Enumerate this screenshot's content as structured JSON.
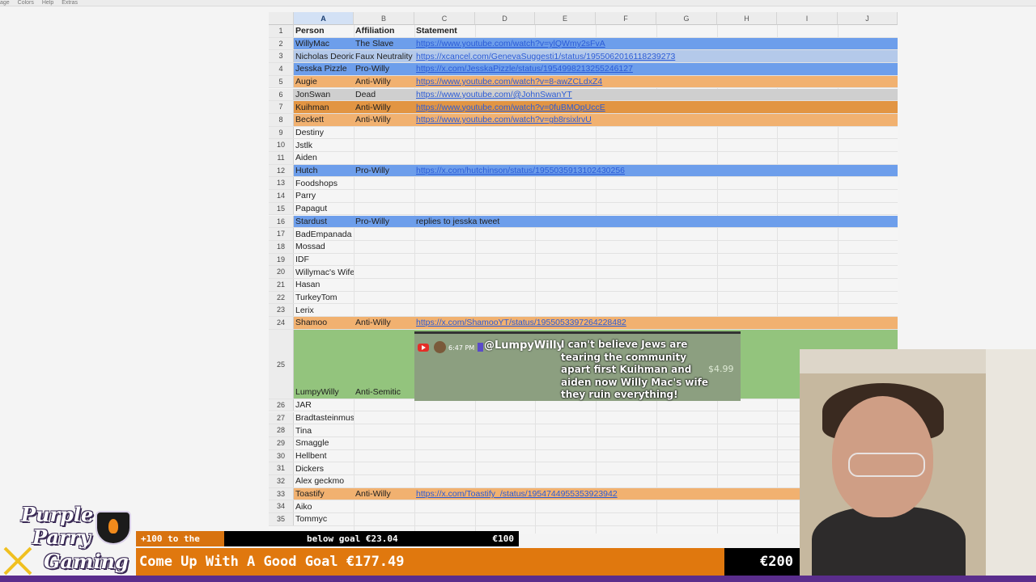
{
  "menubar": [
    "age",
    "Colors",
    "Help",
    "Extras"
  ],
  "columns": [
    {
      "letter": "A",
      "selected": true
    },
    {
      "letter": "B",
      "selected": false
    },
    {
      "letter": "C",
      "selected": false
    },
    {
      "letter": "D",
      "selected": false
    },
    {
      "letter": "E",
      "selected": false
    },
    {
      "letter": "F",
      "selected": false
    },
    {
      "letter": "G",
      "selected": false
    },
    {
      "letter": "H",
      "selected": false
    },
    {
      "letter": "I",
      "selected": false
    },
    {
      "letter": "J",
      "selected": false
    }
  ],
  "rows": [
    {
      "n": "1",
      "a": "Person",
      "b": "Affiliation",
      "c": "Statement",
      "color": "",
      "bold": true,
      "link": false
    },
    {
      "n": "2",
      "a": "WillyMac",
      "b": "The Slave",
      "c": "https://www.youtube.com/watch?v=ylQWmy2sFvA",
      "color": "blue",
      "link": true
    },
    {
      "n": "3",
      "a": "Nicholas Deorio",
      "b": "Faux Neutrality",
      "c": "https://xcancel.com/GenevaSuggesti1/status/1955062016118239273",
      "color": "lightblue",
      "link": true
    },
    {
      "n": "4",
      "a": "Jesska Pizzle",
      "b": "Pro-Willy",
      "c": "https://x.com/JesskaPizzle/status/1954998213255246127",
      "color": "blue",
      "link": true
    },
    {
      "n": "5",
      "a": "Augie",
      "b": "Anti-Willy",
      "c": "https://www.youtube.com/watch?v=8-awZCLdxZ4",
      "color": "orange",
      "link": true
    },
    {
      "n": "6",
      "a": "JonSwan",
      "b": "Dead",
      "c": "https://www.youtube.com/@JohnSwanYT",
      "color": "gray",
      "link": true
    },
    {
      "n": "7",
      "a": "Kuihman",
      "b": "Anti-Willy",
      "c": "https://www.youtube.com/watch?v=0fuBMOpUccE",
      "color": "darkorange",
      "link": true
    },
    {
      "n": "8",
      "a": "Beckett",
      "b": "Anti-Willy",
      "c": "https://www.youtube.com/watch?v=gb8rsixlrvU",
      "color": "orange",
      "link": true
    },
    {
      "n": "9",
      "a": "Destiny",
      "b": "",
      "c": "",
      "color": "",
      "link": false
    },
    {
      "n": "10",
      "a": "Jstlk",
      "b": "",
      "c": "",
      "color": "",
      "link": false
    },
    {
      "n": "11",
      "a": "Aiden",
      "b": "",
      "c": "",
      "color": "",
      "link": false
    },
    {
      "n": "12",
      "a": "Hutch",
      "b": "Pro-Willy",
      "c": "https://x.com/hutchinson/status/1955035913102430256",
      "color": "blue",
      "link": true
    },
    {
      "n": "13",
      "a": "Foodshops",
      "b": "",
      "c": "",
      "color": "",
      "link": false
    },
    {
      "n": "14",
      "a": "Parry",
      "b": "",
      "c": "",
      "color": "",
      "link": false
    },
    {
      "n": "15",
      "a": "Papagut",
      "b": "",
      "c": "",
      "color": "",
      "link": false
    },
    {
      "n": "16",
      "a": "Stardust",
      "b": "Pro-Willy",
      "c": "replies to jesska tweet",
      "color": "blue",
      "link": false
    },
    {
      "n": "17",
      "a": "BadEmpanada",
      "b": "",
      "c": "",
      "color": "",
      "link": false
    },
    {
      "n": "18",
      "a": "Mossad",
      "b": "",
      "c": "",
      "color": "",
      "link": false
    },
    {
      "n": "19",
      "a": "IDF",
      "b": "",
      "c": "",
      "color": "",
      "link": false
    },
    {
      "n": "20",
      "a": "Willymac's Wife",
      "b": "",
      "c": "",
      "color": "",
      "link": false
    },
    {
      "n": "21",
      "a": "Hasan",
      "b": "",
      "c": "",
      "color": "",
      "link": false
    },
    {
      "n": "22",
      "a": "TurkeyTom",
      "b": "",
      "c": "",
      "color": "",
      "link": false
    },
    {
      "n": "23",
      "a": "Lerix",
      "b": "",
      "c": "",
      "color": "",
      "link": false
    },
    {
      "n": "24",
      "a": "Shamoo",
      "b": "Anti-Willy",
      "c": "https://x.com/ShamooYT/status/1955053397264228482",
      "color": "orange",
      "link": true
    },
    {
      "n": "25",
      "a": "LumpyWilly",
      "b": "Anti-Semitic",
      "c": "",
      "color": "green",
      "link": false,
      "tall": true
    },
    {
      "n": "26",
      "a": "JAR",
      "b": "",
      "c": "",
      "color": "",
      "link": false
    },
    {
      "n": "27",
      "a": "Bradtasteinmusic",
      "b": "",
      "c": "",
      "color": "",
      "link": false
    },
    {
      "n": "28",
      "a": "Tina",
      "b": "",
      "c": "",
      "color": "",
      "link": false
    },
    {
      "n": "29",
      "a": "Smaggle",
      "b": "",
      "c": "",
      "color": "",
      "link": false
    },
    {
      "n": "30",
      "a": "Hellbent",
      "b": "",
      "c": "",
      "color": "",
      "link": false
    },
    {
      "n": "31",
      "a": "Dickers",
      "b": "",
      "c": "",
      "color": "",
      "link": false
    },
    {
      "n": "32",
      "a": "Alex geckmo",
      "b": "",
      "c": "",
      "color": "",
      "link": false
    },
    {
      "n": "33",
      "a": "Toastify",
      "b": "Anti-Willy",
      "c": "https://x.com/Toastify_/status/1954744955353923942",
      "color": "orange",
      "link": true
    },
    {
      "n": "34",
      "a": "Aiko",
      "b": "",
      "c": "",
      "color": "",
      "link": false
    },
    {
      "n": "35",
      "a": "Tommyc",
      "b": "",
      "c": "",
      "color": "",
      "link": false
    }
  ],
  "donation": {
    "time": "6:47 PM",
    "user": "@LumpyWilly",
    "message": "I can't believe Jews are tearing the community apart first Kuihman and aiden now Willy Mac's wife they ruin everything!",
    "amount": "$4.99"
  },
  "logo": {
    "line1": "Purple",
    "line2": "Parry",
    "line3": "Gaming"
  },
  "goal_small": {
    "left": "+100 to the",
    "middle": "below goal €23.04",
    "target": "€100",
    "progress": 0.23
  },
  "goal_big": {
    "label": "Come Up With A Good Goal €177.49",
    "target": "€200",
    "progress": 0.887
  },
  "colors": {
    "blue": "#6d9eeb",
    "lightblue": "#b4c9ea",
    "orange": "#f1b170",
    "darkorange": "#e29543",
    "gray": "#cfcfcf",
    "green": "#93c47d",
    "goal_orange": "#e0780e"
  }
}
